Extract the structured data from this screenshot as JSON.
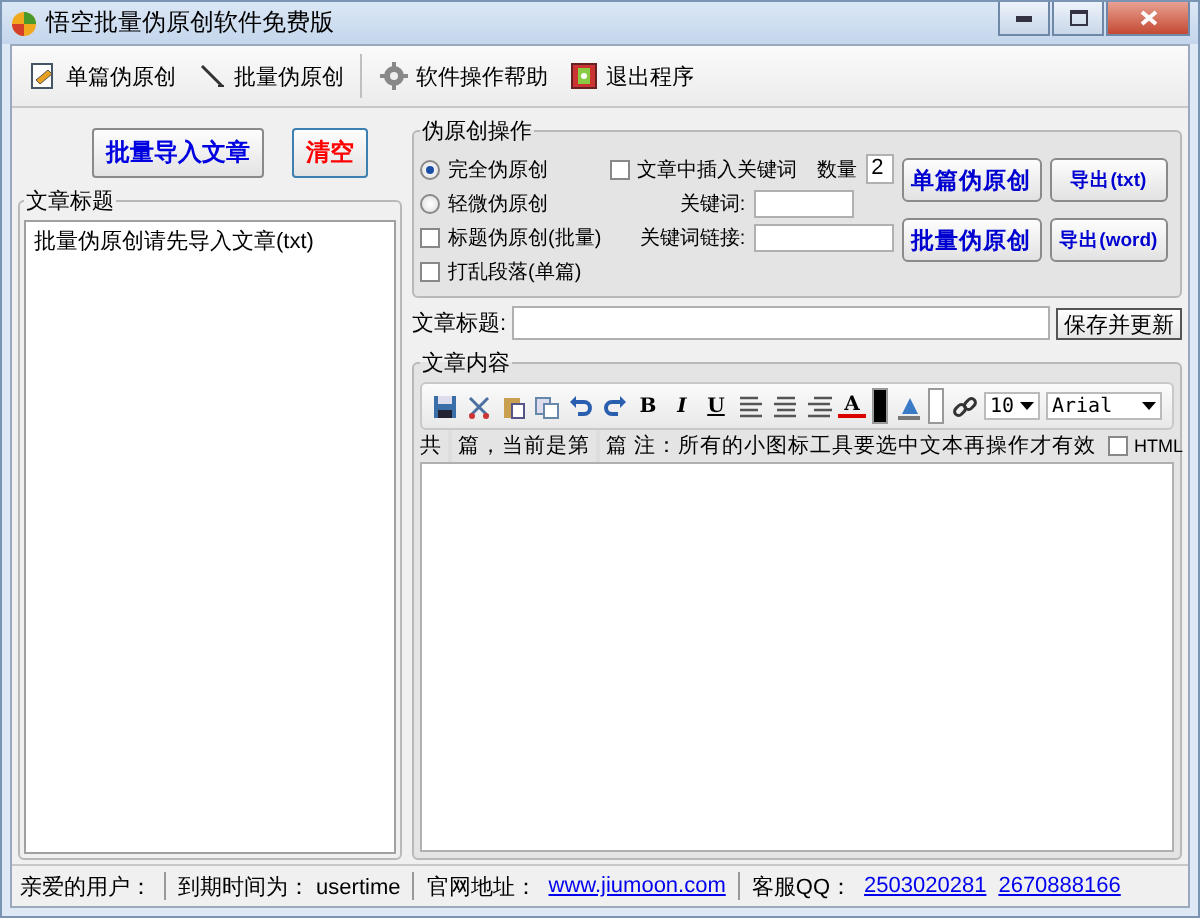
{
  "window": {
    "title": "悟空批量伪原创软件免费版"
  },
  "toolbar": [
    {
      "kind": "single",
      "label": "单篇伪原创"
    },
    {
      "kind": "batch",
      "label": "批量伪原创"
    },
    {
      "kind": "help",
      "label": "软件操作帮助"
    },
    {
      "kind": "exit",
      "label": "退出程序"
    }
  ],
  "left_panel": {
    "import_button": "批量导入文章",
    "clear_button": "清空",
    "list_title": "文章标题",
    "items": [
      {
        "label": "批量伪原创请先导入文章(txt)"
      }
    ]
  },
  "options": {
    "title": "伪原创操作",
    "modes": [
      {
        "label": "完全伪原创",
        "selected": true
      },
      {
        "label": "轻微伪原创",
        "selected": false
      }
    ],
    "checkboxes": [
      {
        "label": "标题伪原创(批量)",
        "checked": false
      },
      {
        "label": "打乱段落(单篇)",
        "checked": false
      }
    ],
    "insert_keyword": {
      "label": "文章中插入关键词",
      "checked": false
    },
    "count": {
      "label": "数量",
      "value": "2"
    },
    "keyword": {
      "label": "关键词:"
    },
    "keyword_link": {
      "label": "关键词链接:"
    },
    "buttons": [
      "单篇伪原创",
      "导出(txt)",
      "批量伪原创",
      "导出(word)"
    ]
  },
  "title_row": {
    "label": "文章标题:",
    "save_button": "保存并更新"
  },
  "content": {
    "title": "文章内容",
    "editor_toolbar": {
      "format_buttons": [
        "B",
        "I",
        "U"
      ],
      "font_color": "A",
      "font_size": "10",
      "font": "Arial"
    },
    "info": {
      "total_label": "共",
      "current_label": "篇，当前是第",
      "unit": "篇",
      "note": "注：所有的小图标工具要选中文本再操作才有效",
      "html": {
        "label": "HTML",
        "checked": false
      }
    }
  },
  "status_bar": [
    {
      "kind": "text",
      "text": "亲爱的用户："
    },
    {
      "kind": "text",
      "text": "到期时间为：  usertime"
    },
    {
      "kind": "text",
      "text": "官网地址："
    },
    {
      "kind": "link",
      "text": "www.jiumoon.com"
    },
    {
      "kind": "text",
      "text": "客服QQ："
    },
    {
      "kind": "link",
      "text": "2503020281"
    },
    {
      "kind": "link",
      "text": "2670888166"
    }
  ]
}
